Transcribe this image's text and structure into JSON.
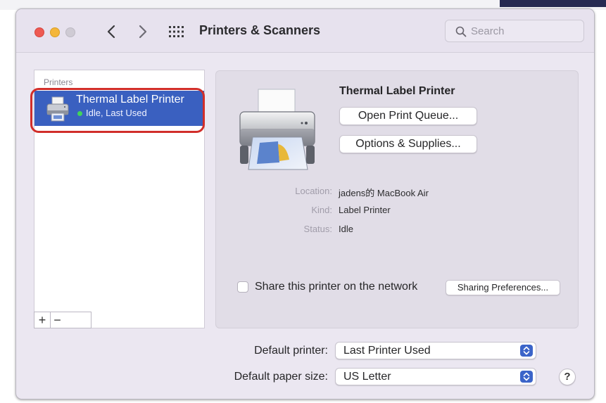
{
  "window": {
    "title": "Printers & Scanners"
  },
  "toolbar": {
    "back_glyph": "<",
    "forward_glyph": ">",
    "show_all_icon": "grid-icon",
    "search_placeholder": "Search",
    "search_icon": "search-icon"
  },
  "sidebar": {
    "header": "Printers",
    "items": [
      {
        "name": "Thermal Label Printer",
        "status": "Idle, Last Used",
        "selected": true,
        "icon": "printer-icon"
      }
    ],
    "add_label": "+",
    "remove_label": "−"
  },
  "detail": {
    "title": "Thermal Label Printer",
    "open_queue_label": "Open Print Queue...",
    "options_label": "Options & Supplies...",
    "location_label": "Location:",
    "location_value": "jadens的 MacBook Air",
    "kind_label": "Kind:",
    "kind_value": "Label Printer",
    "status_label": "Status:",
    "status_value": "Idle",
    "share_label": "Share this printer on the network",
    "share_checked": false,
    "sharing_prefs_label": "Sharing Preferences..."
  },
  "prefs": {
    "default_printer_label": "Default printer:",
    "default_printer_value": "Last Printer Used",
    "paper_size_label": "Default paper size:",
    "paper_size_value": "US Letter",
    "help_label": "?"
  },
  "colors": {
    "selection": "#3a60c0",
    "status_green": "#42d45a",
    "highlight_red": "#d12e2a",
    "close": "#ee5a52",
    "minimize": "#f4b63a"
  }
}
